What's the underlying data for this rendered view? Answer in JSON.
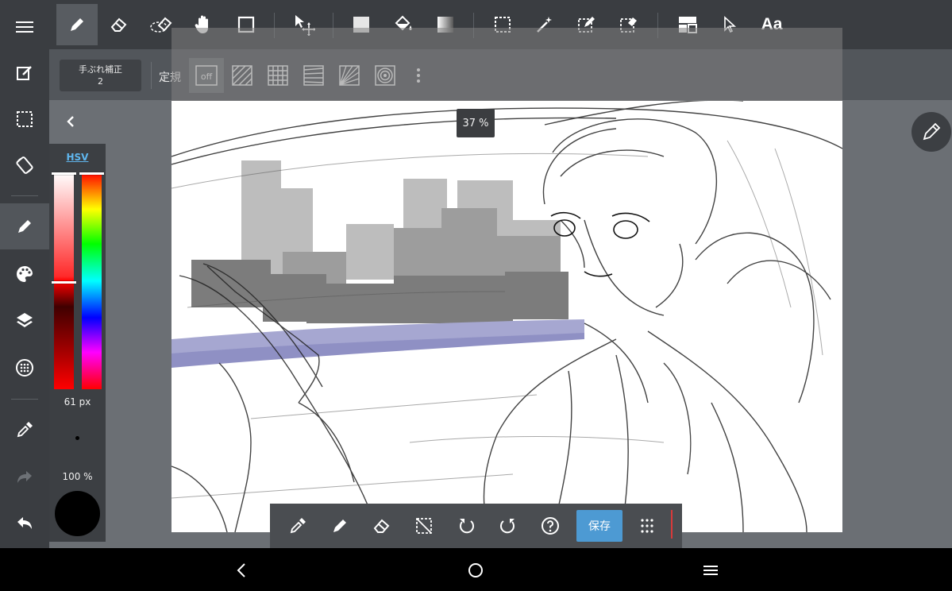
{
  "colors": {
    "toolbar_bg": "#3a3d41",
    "subbar_bg": "#52565b",
    "workspace_bg": "#6b6f74",
    "accent_link": "#5fb6ee",
    "save_button": "#4d9ad3",
    "brush_color": "#000000"
  },
  "left_toolbar": {
    "items": [
      {
        "name": "menu-icon"
      },
      {
        "name": "edit-canvas-icon"
      },
      {
        "name": "selection-icon"
      },
      {
        "name": "rotate-canvas-icon"
      },
      {
        "name": "brush-icon",
        "active": true
      },
      {
        "name": "palette-icon"
      },
      {
        "name": "layers-icon"
      },
      {
        "name": "materials-icon"
      },
      {
        "name": "eyedropper-icon"
      },
      {
        "name": "redo-icon"
      },
      {
        "name": "undo-icon"
      }
    ]
  },
  "top_toolbar": {
    "tools": [
      {
        "name": "pen-tool-icon",
        "active": true
      },
      {
        "name": "eraser-tool-icon"
      },
      {
        "name": "blur-eraser-icon"
      },
      {
        "name": "hand-tool-icon"
      },
      {
        "name": "rectangle-tool-icon"
      },
      {
        "name": "move-tool-icon"
      },
      {
        "name": "fill-rect-icon"
      },
      {
        "name": "bucket-icon"
      },
      {
        "name": "gradient-icon"
      },
      {
        "name": "select-rect-icon"
      },
      {
        "name": "magic-wand-icon"
      },
      {
        "name": "select-pen-icon"
      },
      {
        "name": "select-eraser-icon"
      },
      {
        "name": "frame-divider-icon"
      },
      {
        "name": "cursor-icon"
      },
      {
        "name": "text-tool-icon"
      }
    ],
    "text_tool_label": "Aa"
  },
  "sub_toolbar": {
    "stabilizer_label": "手ぶれ補正",
    "stabilizer_value": "2",
    "ruler_label": "定規",
    "ruler_off_label": "off",
    "rulers": [
      {
        "name": "ruler-off-icon",
        "active": true
      },
      {
        "name": "ruler-parallel-icon"
      },
      {
        "name": "ruler-grid-icon"
      },
      {
        "name": "ruler-perspective-icon"
      },
      {
        "name": "ruler-vanishing-icon"
      },
      {
        "name": "ruler-concentric-icon"
      },
      {
        "name": "more-vertical-icon"
      }
    ]
  },
  "zoom_level": "37 %",
  "color_panel": {
    "mode_label": "HSV",
    "brush_size": "61 px",
    "opacity": "100 %"
  },
  "bottom_toolbar": {
    "buttons": [
      {
        "name": "eyedropper-icon"
      },
      {
        "name": "pen-icon"
      },
      {
        "name": "eraser-icon"
      },
      {
        "name": "deselect-icon"
      },
      {
        "name": "undo-icon"
      },
      {
        "name": "redo-icon"
      },
      {
        "name": "help-icon"
      }
    ],
    "save_label": "保存"
  },
  "nav_bar": {
    "items": [
      {
        "name": "back-icon"
      },
      {
        "name": "home-icon"
      },
      {
        "name": "recents-icon"
      }
    ]
  }
}
